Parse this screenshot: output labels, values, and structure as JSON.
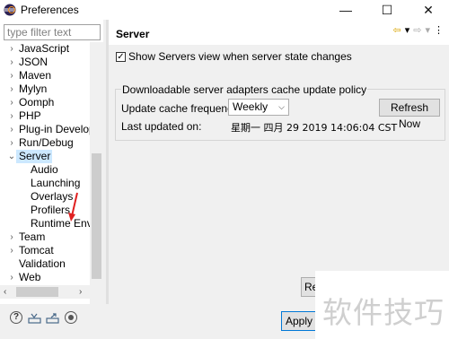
{
  "window": {
    "title": "Preferences",
    "minimize": "—",
    "maximize": "☐",
    "close": "✕"
  },
  "filter": {
    "placeholder": "type filter text"
  },
  "tree": {
    "items": [
      {
        "label": "JavaScript",
        "twisty": "›",
        "indent": 0
      },
      {
        "label": "JSON",
        "twisty": "›",
        "indent": 0
      },
      {
        "label": "Maven",
        "twisty": "›",
        "indent": 0
      },
      {
        "label": "Mylyn",
        "twisty": "›",
        "indent": 0
      },
      {
        "label": "Oomph",
        "twisty": "›",
        "indent": 0
      },
      {
        "label": "PHP",
        "twisty": "›",
        "indent": 0
      },
      {
        "label": "Plug-in Development",
        "twisty": "›",
        "indent": 0
      },
      {
        "label": "Run/Debug",
        "twisty": "›",
        "indent": 0
      },
      {
        "label": "Server",
        "twisty": "⌄",
        "indent": 0,
        "selected": true
      },
      {
        "label": "Audio",
        "twisty": "",
        "indent": 1
      },
      {
        "label": "Launching",
        "twisty": "",
        "indent": 1
      },
      {
        "label": "Overlays",
        "twisty": "",
        "indent": 1
      },
      {
        "label": "Profilers",
        "twisty": "",
        "indent": 1
      },
      {
        "label": "Runtime Environments",
        "twisty": "",
        "indent": 1
      },
      {
        "label": "Team",
        "twisty": "›",
        "indent": 0
      },
      {
        "label": "Tomcat",
        "twisty": "›",
        "indent": 0
      },
      {
        "label": "Validation",
        "twisty": "",
        "indent": 0
      },
      {
        "label": "Web",
        "twisty": "›",
        "indent": 0
      }
    ],
    "scroll_left": "‹",
    "scroll_right": "›"
  },
  "page": {
    "title": "Server",
    "nav": {
      "back": "⇦",
      "back_menu": "▾",
      "forward": "⇨",
      "forward_menu": "▾",
      "view_menu": "⋮"
    },
    "show_servers_view": {
      "label": "Show Servers view when server state changes",
      "checked": true,
      "mark": "✓"
    },
    "cache_group": {
      "title": "Downloadable server adapters cache update policy",
      "frequency_label": "Update cache frequency:",
      "frequency_value": "Weekly",
      "refresh_button": "Refresh Now",
      "last_updated_label": "Last updated on:",
      "last_updated_value": "星期一 四月 29 2019 14:06:04 CST"
    },
    "restore_defaults": "Restore Defaults"
  },
  "footer": {
    "help": "?",
    "apply_and_close": "Apply and Close"
  },
  "watermark": "软件技巧",
  "colors": {
    "selection": "#cce8ff",
    "accent": "#0078d7",
    "annotation_arrow": "#e02020"
  }
}
